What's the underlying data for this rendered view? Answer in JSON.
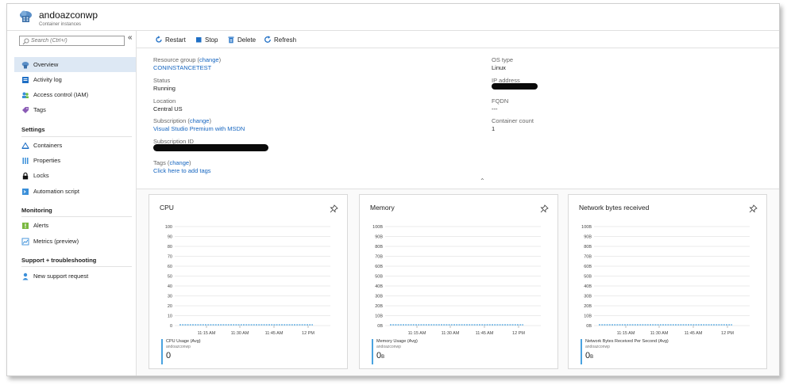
{
  "resource": {
    "title": "andoazconwp",
    "subtitle": "Container instances"
  },
  "search": {
    "placeholder": "Search (Ctrl+/)",
    "collapse": "«"
  },
  "sidebar": {
    "items": [
      {
        "label": "Overview",
        "icon": "cloud-icon"
      },
      {
        "label": "Activity log",
        "icon": "activity-log-icon"
      },
      {
        "label": "Access control (IAM)",
        "icon": "people-icon"
      },
      {
        "label": "Tags",
        "icon": "tag-icon"
      }
    ],
    "sections": [
      {
        "title": "Settings",
        "items": [
          {
            "label": "Containers",
            "icon": "containers-icon"
          },
          {
            "label": "Properties",
            "icon": "properties-icon"
          },
          {
            "label": "Locks",
            "icon": "lock-icon"
          },
          {
            "label": "Automation script",
            "icon": "script-icon"
          }
        ]
      },
      {
        "title": "Monitoring",
        "items": [
          {
            "label": "Alerts",
            "icon": "alert-icon"
          },
          {
            "label": "Metrics (preview)",
            "icon": "metrics-icon"
          }
        ]
      },
      {
        "title": "Support + troubleshooting",
        "items": [
          {
            "label": "New support request",
            "icon": "support-icon"
          }
        ]
      }
    ]
  },
  "toolbar": {
    "restart": "Restart",
    "stop": "Stop",
    "delete": "Delete",
    "refresh": "Refresh"
  },
  "essentials": {
    "resource_group": {
      "label": "Resource group",
      "change": "change",
      "value": "CONINSTANCETEST"
    },
    "status": {
      "label": "Status",
      "value": "Running"
    },
    "location": {
      "label": "Location",
      "value": "Central US"
    },
    "subscription": {
      "label": "Subscription",
      "change": "change",
      "value": "Visual Studio Premium with MSDN"
    },
    "subscription_id": {
      "label": "Subscription ID"
    },
    "tags": {
      "label": "Tags",
      "change": "change",
      "value": "Click here to add tags"
    },
    "os_type": {
      "label": "OS type",
      "value": "Linux"
    },
    "ip_address": {
      "label": "IP address"
    },
    "fqdn": {
      "label": "FQDN",
      "value": "---"
    },
    "container_count": {
      "label": "Container count",
      "value": "1"
    }
  },
  "colors": {
    "accent": "#1565c0",
    "series": "#4aa3e0",
    "active_nav": "#dde8f4"
  },
  "chart_data": [
    {
      "type": "line",
      "title": "CPU",
      "yticks": [
        "100",
        "90",
        "80",
        "70",
        "60",
        "50",
        "40",
        "30",
        "20",
        "10",
        "0"
      ],
      "xticks": [
        "11:15 AM",
        "11:30 AM",
        "11:45 AM",
        "12 PM"
      ],
      "series": [
        {
          "name": "CPU Usage (Avg)",
          "resource": "andoazconwp",
          "values": [
            0,
            0,
            0,
            0,
            0,
            0,
            0,
            0,
            0,
            0,
            0,
            0,
            0,
            0,
            0,
            0,
            0,
            0,
            0,
            0
          ]
        }
      ],
      "summary": {
        "value": "0",
        "unit": ""
      },
      "ylim": [
        0,
        100
      ],
      "grid": true
    },
    {
      "type": "line",
      "title": "Memory",
      "yticks": [
        "100B",
        "90B",
        "80B",
        "70B",
        "60B",
        "50B",
        "40B",
        "30B",
        "20B",
        "10B",
        "0B"
      ],
      "xticks": [
        "11:15 AM",
        "11:30 AM",
        "11:45 AM",
        "12 PM"
      ],
      "series": [
        {
          "name": "Memory Usage (Avg)",
          "resource": "andoazconwp",
          "values": [
            0,
            0,
            0,
            0,
            0,
            0,
            0,
            0,
            0,
            0,
            0,
            0,
            0,
            0,
            0,
            0,
            0,
            0,
            0,
            0
          ]
        }
      ],
      "summary": {
        "value": "0",
        "unit": "B"
      },
      "ylim": [
        0,
        100
      ],
      "grid": true
    },
    {
      "type": "line",
      "title": "Network bytes received",
      "yticks": [
        "100B",
        "90B",
        "80B",
        "70B",
        "60B",
        "50B",
        "40B",
        "30B",
        "20B",
        "10B",
        "0B"
      ],
      "xticks": [
        "11:15 AM",
        "11:30 AM",
        "11:45 AM",
        "12 PM"
      ],
      "series": [
        {
          "name": "Network Bytes Received Per Second (Avg)",
          "resource": "andoazconwp",
          "values": [
            0,
            0,
            0,
            0,
            0,
            0,
            0,
            0,
            0,
            0,
            0,
            0,
            0,
            0,
            0,
            0,
            0,
            0,
            0,
            0
          ]
        }
      ],
      "summary": {
        "value": "0",
        "unit": "B"
      },
      "ylim": [
        0,
        100
      ],
      "grid": true
    }
  ]
}
